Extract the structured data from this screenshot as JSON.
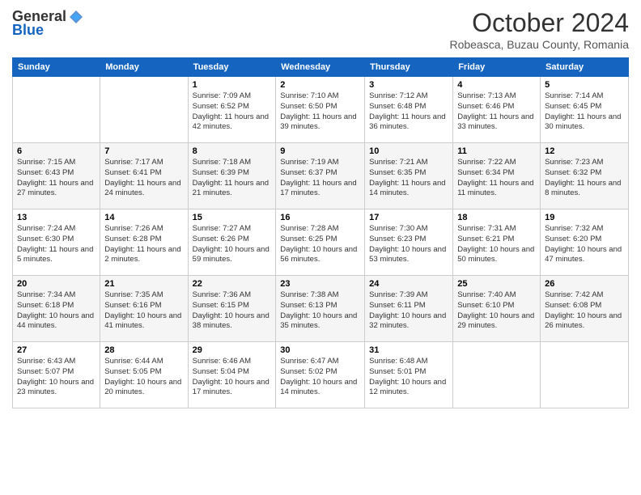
{
  "header": {
    "logo_general": "General",
    "logo_blue": "Blue",
    "month_title": "October 2024",
    "location": "Robeasca, Buzau County, Romania"
  },
  "days_of_week": [
    "Sunday",
    "Monday",
    "Tuesday",
    "Wednesday",
    "Thursday",
    "Friday",
    "Saturday"
  ],
  "weeks": [
    [
      {
        "day": "",
        "info": ""
      },
      {
        "day": "",
        "info": ""
      },
      {
        "day": "1",
        "info": "Sunrise: 7:09 AM\nSunset: 6:52 PM\nDaylight: 11 hours and 42 minutes."
      },
      {
        "day": "2",
        "info": "Sunrise: 7:10 AM\nSunset: 6:50 PM\nDaylight: 11 hours and 39 minutes."
      },
      {
        "day": "3",
        "info": "Sunrise: 7:12 AM\nSunset: 6:48 PM\nDaylight: 11 hours and 36 minutes."
      },
      {
        "day": "4",
        "info": "Sunrise: 7:13 AM\nSunset: 6:46 PM\nDaylight: 11 hours and 33 minutes."
      },
      {
        "day": "5",
        "info": "Sunrise: 7:14 AM\nSunset: 6:45 PM\nDaylight: 11 hours and 30 minutes."
      }
    ],
    [
      {
        "day": "6",
        "info": "Sunrise: 7:15 AM\nSunset: 6:43 PM\nDaylight: 11 hours and 27 minutes."
      },
      {
        "day": "7",
        "info": "Sunrise: 7:17 AM\nSunset: 6:41 PM\nDaylight: 11 hours and 24 minutes."
      },
      {
        "day": "8",
        "info": "Sunrise: 7:18 AM\nSunset: 6:39 PM\nDaylight: 11 hours and 21 minutes."
      },
      {
        "day": "9",
        "info": "Sunrise: 7:19 AM\nSunset: 6:37 PM\nDaylight: 11 hours and 17 minutes."
      },
      {
        "day": "10",
        "info": "Sunrise: 7:21 AM\nSunset: 6:35 PM\nDaylight: 11 hours and 14 minutes."
      },
      {
        "day": "11",
        "info": "Sunrise: 7:22 AM\nSunset: 6:34 PM\nDaylight: 11 hours and 11 minutes."
      },
      {
        "day": "12",
        "info": "Sunrise: 7:23 AM\nSunset: 6:32 PM\nDaylight: 11 hours and 8 minutes."
      }
    ],
    [
      {
        "day": "13",
        "info": "Sunrise: 7:24 AM\nSunset: 6:30 PM\nDaylight: 11 hours and 5 minutes."
      },
      {
        "day": "14",
        "info": "Sunrise: 7:26 AM\nSunset: 6:28 PM\nDaylight: 11 hours and 2 minutes."
      },
      {
        "day": "15",
        "info": "Sunrise: 7:27 AM\nSunset: 6:26 PM\nDaylight: 10 hours and 59 minutes."
      },
      {
        "day": "16",
        "info": "Sunrise: 7:28 AM\nSunset: 6:25 PM\nDaylight: 10 hours and 56 minutes."
      },
      {
        "day": "17",
        "info": "Sunrise: 7:30 AM\nSunset: 6:23 PM\nDaylight: 10 hours and 53 minutes."
      },
      {
        "day": "18",
        "info": "Sunrise: 7:31 AM\nSunset: 6:21 PM\nDaylight: 10 hours and 50 minutes."
      },
      {
        "day": "19",
        "info": "Sunrise: 7:32 AM\nSunset: 6:20 PM\nDaylight: 10 hours and 47 minutes."
      }
    ],
    [
      {
        "day": "20",
        "info": "Sunrise: 7:34 AM\nSunset: 6:18 PM\nDaylight: 10 hours and 44 minutes."
      },
      {
        "day": "21",
        "info": "Sunrise: 7:35 AM\nSunset: 6:16 PM\nDaylight: 10 hours and 41 minutes."
      },
      {
        "day": "22",
        "info": "Sunrise: 7:36 AM\nSunset: 6:15 PM\nDaylight: 10 hours and 38 minutes."
      },
      {
        "day": "23",
        "info": "Sunrise: 7:38 AM\nSunset: 6:13 PM\nDaylight: 10 hours and 35 minutes."
      },
      {
        "day": "24",
        "info": "Sunrise: 7:39 AM\nSunset: 6:11 PM\nDaylight: 10 hours and 32 minutes."
      },
      {
        "day": "25",
        "info": "Sunrise: 7:40 AM\nSunset: 6:10 PM\nDaylight: 10 hours and 29 minutes."
      },
      {
        "day": "26",
        "info": "Sunrise: 7:42 AM\nSunset: 6:08 PM\nDaylight: 10 hours and 26 minutes."
      }
    ],
    [
      {
        "day": "27",
        "info": "Sunrise: 6:43 AM\nSunset: 5:07 PM\nDaylight: 10 hours and 23 minutes."
      },
      {
        "day": "28",
        "info": "Sunrise: 6:44 AM\nSunset: 5:05 PM\nDaylight: 10 hours and 20 minutes."
      },
      {
        "day": "29",
        "info": "Sunrise: 6:46 AM\nSunset: 5:04 PM\nDaylight: 10 hours and 17 minutes."
      },
      {
        "day": "30",
        "info": "Sunrise: 6:47 AM\nSunset: 5:02 PM\nDaylight: 10 hours and 14 minutes."
      },
      {
        "day": "31",
        "info": "Sunrise: 6:48 AM\nSunset: 5:01 PM\nDaylight: 10 hours and 12 minutes."
      },
      {
        "day": "",
        "info": ""
      },
      {
        "day": "",
        "info": ""
      }
    ]
  ]
}
